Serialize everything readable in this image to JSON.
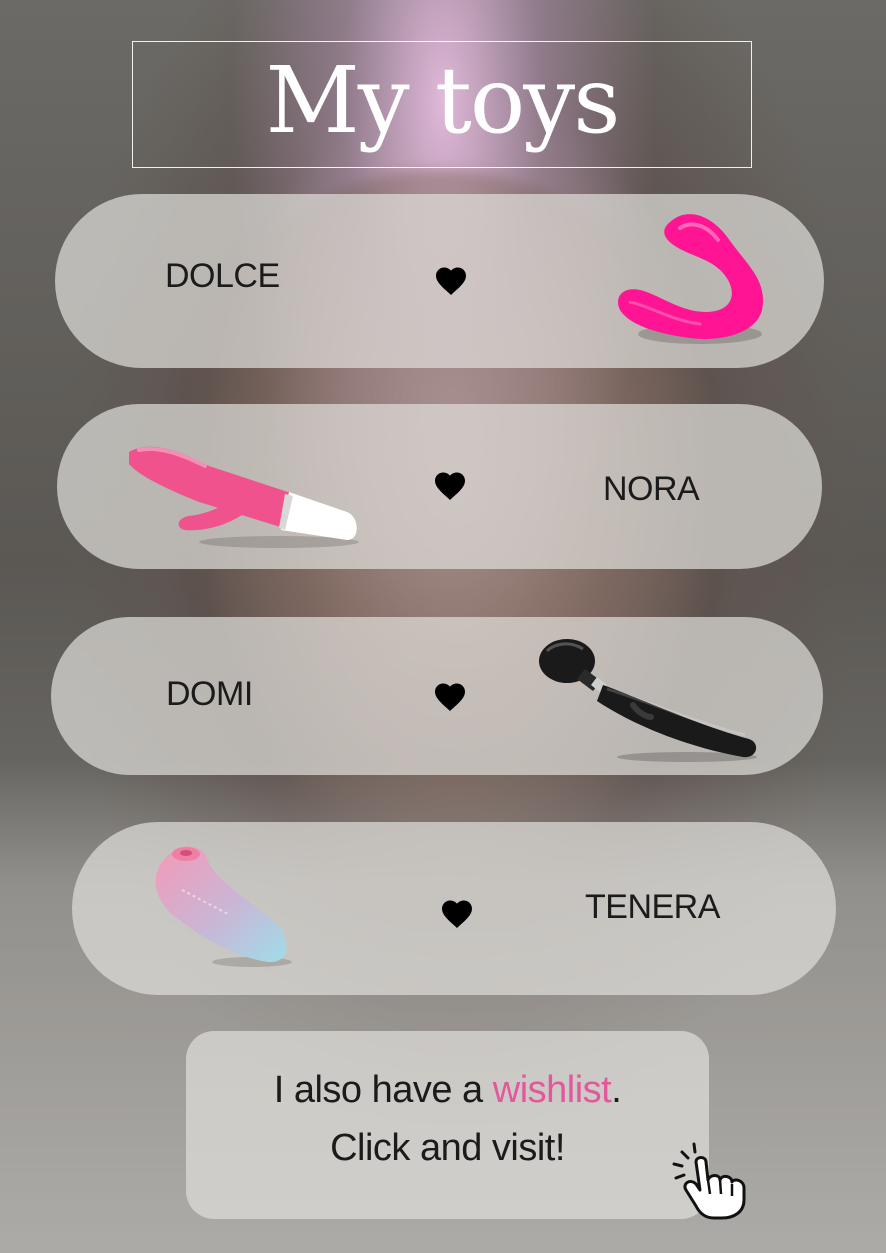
{
  "title": "My toys",
  "toys": [
    {
      "name": "DOLCE"
    },
    {
      "name": "NORA"
    },
    {
      "name": "DOMI"
    },
    {
      "name": "TENERA"
    }
  ],
  "wishlist": {
    "line1_prefix": "I also have a ",
    "line1_link": "wishlist",
    "line1_suffix": ".",
    "line2": "Click and visit!"
  },
  "colors": {
    "link": "#e2589a",
    "heart": "#000000",
    "dolce": "#ff1493",
    "nora": "#f0528e",
    "domi": "#1a1a1a",
    "tenera_top": "#f39ab6",
    "tenera_bottom": "#9fdde8"
  },
  "icons": {
    "heart": "heart-icon",
    "pointer": "pointer-hand-icon"
  }
}
